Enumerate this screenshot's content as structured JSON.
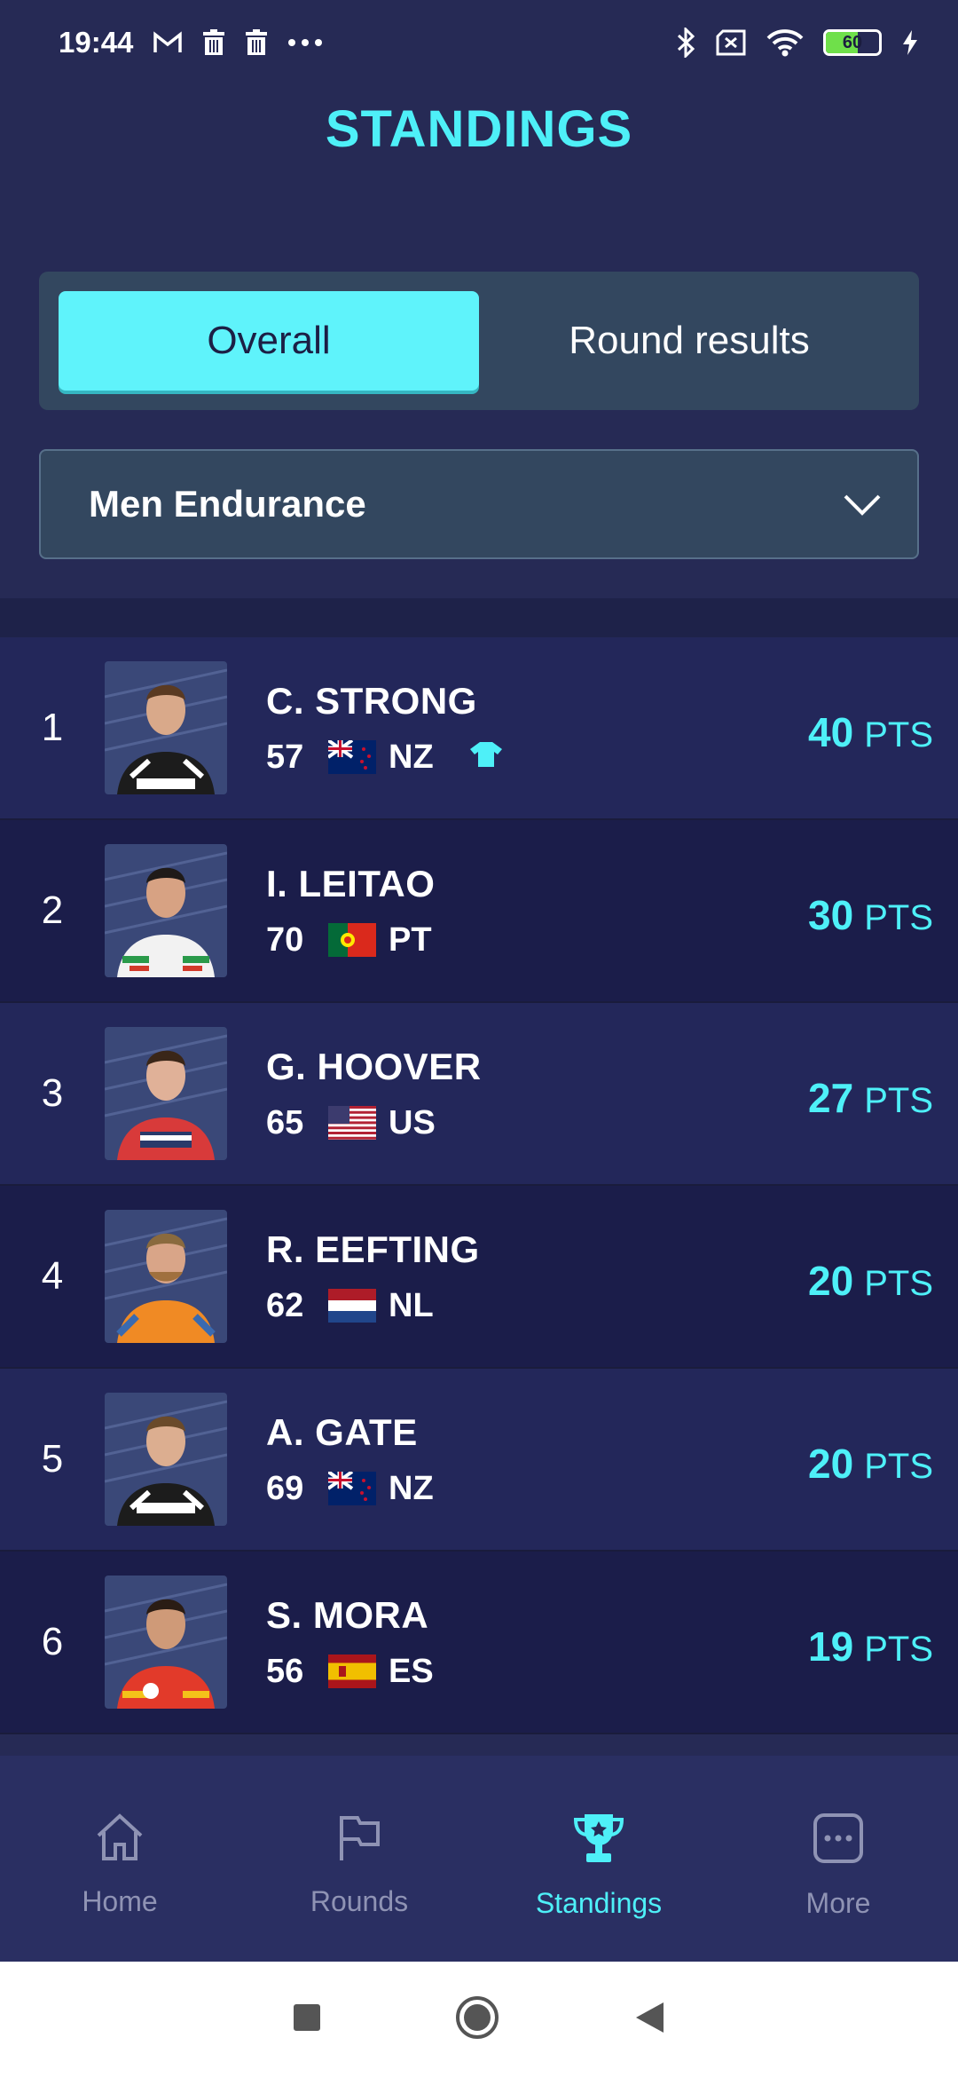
{
  "status_bar": {
    "time": "19:44",
    "battery": "60",
    "battery_level": 0.6
  },
  "page_title": "STANDINGS",
  "tabs": [
    {
      "label": "Overall",
      "active": true
    },
    {
      "label": "Round results",
      "active": false
    }
  ],
  "category_select": {
    "value": "Men Endurance"
  },
  "standings": [
    {
      "rank": "1",
      "name": "C. STRONG",
      "number": "57",
      "country": "NZ",
      "points": "40",
      "unit": "PTS",
      "leader_jersey": true
    },
    {
      "rank": "2",
      "name": "I. LEITAO",
      "number": "70",
      "country": "PT",
      "points": "30",
      "unit": "PTS"
    },
    {
      "rank": "3",
      "name": "G. HOOVER",
      "number": "65",
      "country": "US",
      "points": "27",
      "unit": "PTS"
    },
    {
      "rank": "4",
      "name": "R. EEFTING",
      "number": "62",
      "country": "NL",
      "points": "20",
      "unit": "PTS"
    },
    {
      "rank": "5",
      "name": "A. GATE",
      "number": "69",
      "country": "NZ",
      "points": "20",
      "unit": "PTS"
    },
    {
      "rank": "6",
      "name": "S. MORA",
      "number": "56",
      "country": "ES",
      "points": "19",
      "unit": "PTS"
    }
  ],
  "bottom_nav": [
    {
      "label": "Home",
      "icon": "home-icon"
    },
    {
      "label": "Rounds",
      "icon": "flag-icon"
    },
    {
      "label": "Standings",
      "icon": "trophy-icon",
      "active": true
    },
    {
      "label": "More",
      "icon": "more-icon"
    }
  ],
  "colors": {
    "accent": "#4ef0f8",
    "background": "#262a55",
    "panel": "#33475f"
  }
}
